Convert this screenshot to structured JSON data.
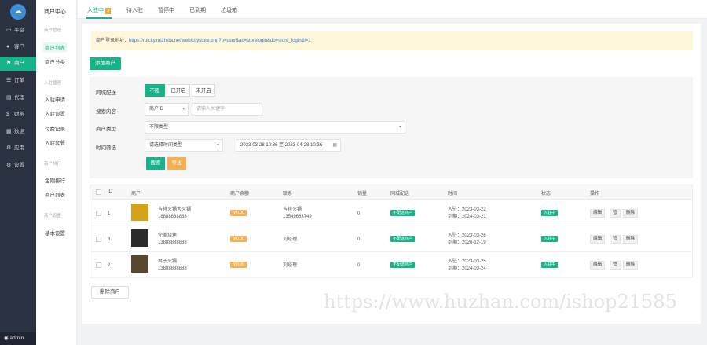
{
  "sidebar": {
    "logo": "☁",
    "items": [
      {
        "icon": "▭",
        "label": "平台",
        "active": false
      },
      {
        "icon": "●",
        "label": "客户",
        "active": false
      },
      {
        "icon": "⚑",
        "label": "商户",
        "active": true
      },
      {
        "icon": "☰",
        "label": "订单",
        "active": false
      },
      {
        "icon": "▤",
        "label": "代理",
        "active": false
      },
      {
        "icon": "$",
        "label": "财务",
        "active": false
      },
      {
        "icon": "▦",
        "label": "数据",
        "active": false
      },
      {
        "icon": "⚙",
        "label": "应用",
        "active": false
      },
      {
        "icon": "⚙",
        "label": "设置",
        "active": false
      }
    ],
    "user": "admin"
  },
  "subnav": {
    "title": "商户中心",
    "groups": [
      {
        "label": "商户管理",
        "items": [
          {
            "label": "商户列表",
            "active": true
          },
          {
            "label": "商户分类",
            "active": false
          }
        ]
      },
      {
        "label": "入驻管理",
        "items": [
          {
            "label": "入驻申请",
            "active": false
          },
          {
            "label": "入驻设置",
            "active": false
          },
          {
            "label": "付费记录",
            "active": false
          },
          {
            "label": "入驻套餐",
            "active": false
          }
        ]
      },
      {
        "label": "商户排行",
        "items": [
          {
            "label": "金刚排行",
            "active": false
          },
          {
            "label": "商户列表",
            "active": false
          }
        ]
      },
      {
        "label": "商户设置",
        "items": [
          {
            "label": "基本设置",
            "active": false
          }
        ]
      }
    ]
  },
  "tabs": [
    {
      "label": "入驻中",
      "count": "3",
      "active": true
    },
    {
      "label": "待入驻",
      "count": "",
      "active": false
    },
    {
      "label": "暂停中",
      "count": "",
      "active": false
    },
    {
      "label": "已到期",
      "count": "",
      "active": false
    },
    {
      "label": "垃圾箱",
      "count": "",
      "active": false
    }
  ],
  "notice": {
    "label": "商户登录地址：",
    "url": "https://ruicity.ruizhida.net/web/citystore.php?p=user&ac=storelogin&do=store_login&i=1"
  },
  "add_button": "添加商户",
  "filter": {
    "status_label": "同城配送",
    "status_options": [
      {
        "label": "不限",
        "active": true
      },
      {
        "label": "已开启",
        "active": false
      },
      {
        "label": "未开启",
        "active": false
      }
    ],
    "search_label": "搜索内容",
    "search_field": "商户ID",
    "search_placeholder": "请输入关键字",
    "category_label": "商户类型",
    "category_value": "不限类型",
    "time_label": "时间筛选",
    "time_type": "请选择时间类型",
    "date_range": "2023-03-28 10:36 至 2023-04-28 10:36",
    "search_button": "搜索",
    "export_button": "导出"
  },
  "table": {
    "headers": [
      "ID",
      "商户",
      "商户余额",
      "联系",
      "销量",
      "同城配送",
      "时间",
      "状态",
      "操作"
    ],
    "rows": [
      {
        "id": "1",
        "name": "吉祥火锅大火锅",
        "phone": "18888888888",
        "balance": "￥0.00",
        "contact": "吉祥火锅",
        "contact_phone": "13549663749",
        "sales": "0",
        "delivery": "不配送商户",
        "join": "入驻：2023-03-22",
        "expire": "到期：2024-03-21",
        "status": "入驻中",
        "ops": [
          "编辑",
          "管",
          "删除"
        ]
      },
      {
        "id": "3",
        "name": "完美烧烤",
        "phone": "13888888888",
        "balance": "￥0.00",
        "contact": "刘经理",
        "contact_phone": "",
        "sales": "0",
        "delivery": "不配送商户",
        "join": "入驻：2023-03-26",
        "expire": "到期：2026-12-19",
        "status": "入驻中",
        "ops": [
          "编辑",
          "管",
          "删除"
        ]
      },
      {
        "id": "2",
        "name": "君子火锅",
        "phone": "13888888888",
        "balance": "￥0.00",
        "contact": "刘经理",
        "contact_phone": "",
        "sales": "0",
        "delivery": "不配送商户",
        "join": "入驻：2023-03-25",
        "expire": "到期：2024-03-24",
        "status": "入驻中",
        "ops": [
          "编辑",
          "管",
          "删除"
        ]
      }
    ]
  },
  "delete_button": "删除商户",
  "watermark": "https://www.huzhan.com/ishop21585",
  "colors": {
    "sidebar": "#2a3140",
    "accent": "#19b38a",
    "warn": "#f5b054",
    "notice_bg": "#fdf6d9"
  }
}
